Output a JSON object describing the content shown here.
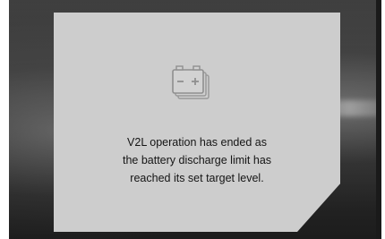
{
  "dialog": {
    "icon": "battery-icon",
    "message_lines": [
      "V2L operation has ended as",
      "the battery discharge limit has",
      "reached its set target level."
    ]
  },
  "colors": {
    "card_background": "#cdcdcd",
    "text": "#151515",
    "frame_background": "#3c3c3c"
  }
}
